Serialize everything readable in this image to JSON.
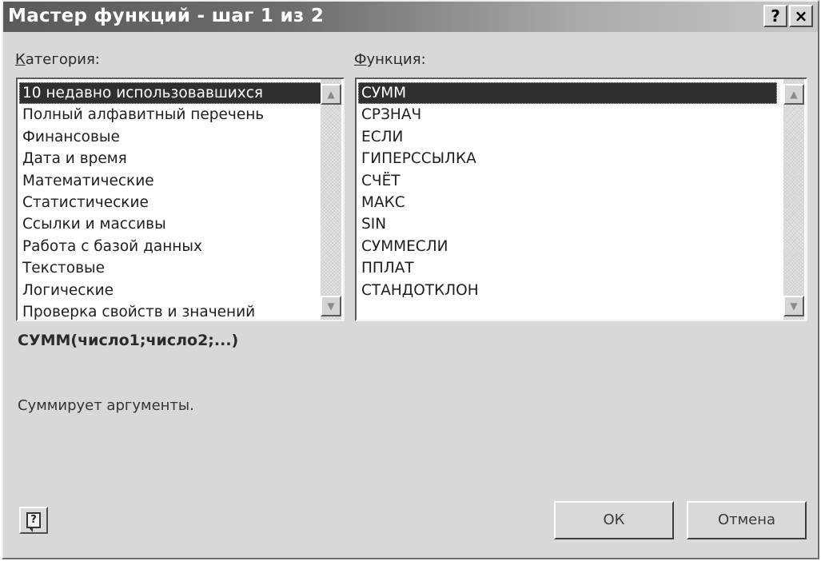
{
  "window": {
    "title": "Мастер функций - шаг 1 из 2",
    "help_glyph": "?",
    "close_glyph": "×"
  },
  "category": {
    "label_accel": "К",
    "label_rest": "атегория:",
    "items": [
      "10 недавно использовавшихся",
      "Полный алфавитный перечень",
      "Финансовые",
      "Дата и время",
      "Математические",
      "Статистические",
      "Ссылки и массивы",
      "Работа с базой данных",
      "Текстовые",
      "Логические",
      "Проверка свойств и значений"
    ],
    "selected_index": 0
  },
  "function": {
    "label_accel": "Ф",
    "label_rest": "ункция:",
    "items": [
      "СУММ",
      "СРЗНАЧ",
      "ЕСЛИ",
      "ГИПЕРССЫЛКА",
      "СЧЁТ",
      "МАКС",
      "SIN",
      "СУММЕСЛИ",
      "ППЛАТ",
      "СТАНДОТКЛОН"
    ],
    "selected_index": 0
  },
  "details": {
    "signature": "СУММ(число1;число2;...)",
    "description": "Суммирует аргументы."
  },
  "buttons": {
    "help_icon": "?",
    "ok": "ОК",
    "cancel": "Отмена"
  },
  "icons": {
    "scroll_up": "up-arrow-icon",
    "scroll_down": "down-arrow-icon",
    "help": "help-balloon-icon"
  },
  "colors": {
    "dialog_bg": "#d8d8d8",
    "selection_bg": "#2f2f2f",
    "title_start": "#5a5a5a"
  }
}
